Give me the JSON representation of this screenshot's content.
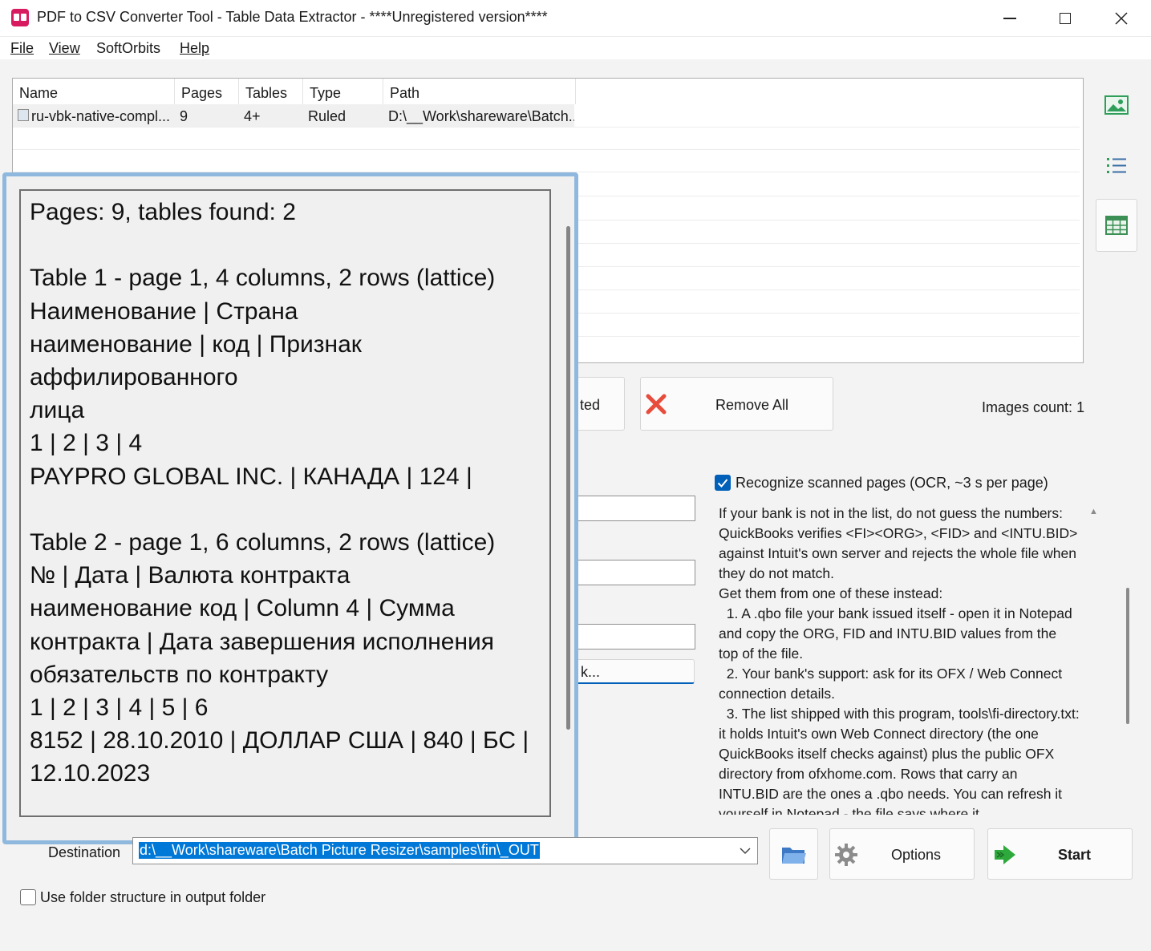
{
  "window": {
    "title": "PDF to CSV Converter Tool - Table Data Extractor - ****Unregistered version****"
  },
  "menu": {
    "file": "File",
    "view": "View",
    "softorbits": "SoftOrbits",
    "help": "Help"
  },
  "filelist": {
    "columns": [
      "Name",
      "Pages",
      "Tables",
      "Type",
      "Path"
    ],
    "rows": [
      {
        "name": "ru-vbk-native-compl...",
        "pages": "9",
        "tables": "4+",
        "type": "Ruled",
        "path": "D:\\__Work\\shareware\\Batch..."
      }
    ]
  },
  "buttons": {
    "remove_selected_partial": "ted",
    "remove_all": "Remove All",
    "options": "Options",
    "start": "Start",
    "browse_partial": "k..."
  },
  "images_count": "Images count: 1",
  "ocr": {
    "checked": true,
    "label": "Recognize scanned pages (OCR, ~3 s per page)"
  },
  "info_text": "If your bank is not in the list, do not guess the numbers: QuickBooks verifies <FI><ORG>, <FID> and <INTU.BID> against Intuit's own server and rejects the whole file when they do not match.\nGet them from one of these instead:\n  1. A .qbo file your bank issued itself - open it in Notepad and copy the ORG, FID and INTU.BID values from the top of the file.\n  2. Your bank's support: ask for its OFX / Web Connect connection details.\n  3. The list shipped with this program, tools\\fi-directory.txt: it holds Intuit's own Web Connect directory (the one QuickBooks itself checks against) plus the public OFX directory from ofxhome.com. Rows that carry an INTU.BID are the ones a .qbo needs. You can refresh it yourself in Notepad - the file says where it",
  "popup_text": "Pages: 9, tables found: 2\n\nTable 1 - page 1, 4 columns, 2 rows (lattice)\nНаименование | Страна\nнаименование | код | Признак\nаффилированного\nлица\n1 | 2 | 3 | 4\nPAYPRO GLOBAL INC. | КАНАДА | 124 |\n\nTable 2 - page 1, 6 columns, 2 rows (lattice)\n№ | Дата | Валюта контракта\nнаименование код | Column 4 | Сумма\nконтракта | Дата завершения исполнения\nобязательств по контракту\n1 | 2 | 3 | 4 | 5 | 6\n8152 | 28.10.2010 | ДОЛЛАР США | 840 | БС |\n12.10.2023",
  "destination": {
    "label": "Destination",
    "value": "d:\\__Work\\shareware\\Batch Picture Resizer\\samples\\fin\\_OUT"
  },
  "folder_structure": {
    "checked": false,
    "label": "Use folder structure in output folder"
  },
  "colors": {
    "accent": "#005fb8",
    "popup_border": "#8fb8de",
    "selection": "#0078d7",
    "remove_red": "#e74c3c",
    "start_green": "#2eaa3c"
  }
}
